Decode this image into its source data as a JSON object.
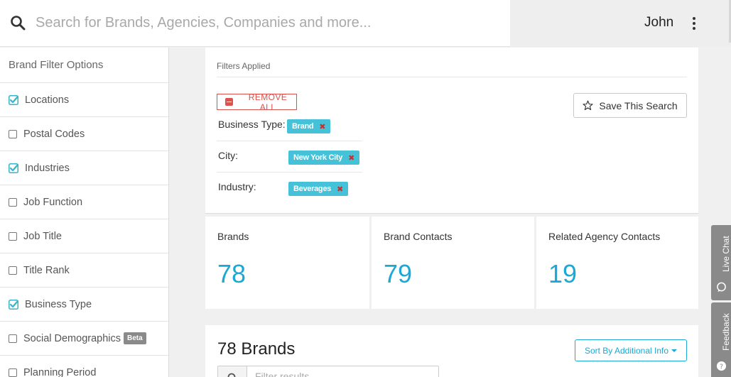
{
  "search": {
    "placeholder": "Search for Brands, Agencies, Companies and more..."
  },
  "user": {
    "name": "John"
  },
  "sidebar": {
    "title": "Brand Filter Options",
    "items": [
      {
        "label": "Locations",
        "checked": true
      },
      {
        "label": "Postal Codes",
        "checked": false
      },
      {
        "label": "Industries",
        "checked": true
      },
      {
        "label": "Job Function",
        "checked": false
      },
      {
        "label": "Job Title",
        "checked": false
      },
      {
        "label": "Title Rank",
        "checked": false
      },
      {
        "label": "Business Type",
        "checked": true
      },
      {
        "label": "Social Demographics",
        "checked": false,
        "badge": "Beta"
      },
      {
        "label": "Planning Period",
        "checked": false
      }
    ]
  },
  "filters": {
    "title": "Filters Applied",
    "remove_all": "REMOVE ALL",
    "save_search": "Save This Search",
    "applied": [
      {
        "label": "Business Type:",
        "chip": "Brand"
      },
      {
        "label": "City:",
        "chip": "New York City"
      },
      {
        "label": "Industry:",
        "chip": "Beverages"
      }
    ],
    "chip_remove": "✖"
  },
  "stats": [
    {
      "label": "Brands",
      "value": "78"
    },
    {
      "label": "Brand Contacts",
      "value": "79"
    },
    {
      "label": "Related Agency Contacts",
      "value": "19"
    }
  ],
  "results": {
    "title": "78 Brands",
    "sort_label": "Sort By Additional Info",
    "filter_placeholder": "Filter results..."
  },
  "side_tabs": {
    "live_chat": "Live Chat",
    "feedback": "Feedback"
  },
  "colors": {
    "accent": "#1ba8d4",
    "chip": "#45c2d8",
    "danger": "#d9534f",
    "check": "#3bb3c7"
  },
  "icons": [
    "search-icon",
    "kebab-menu-icon",
    "checkbox-checked-icon",
    "minus-icon",
    "star-icon",
    "chat-bubble-icon"
  ]
}
